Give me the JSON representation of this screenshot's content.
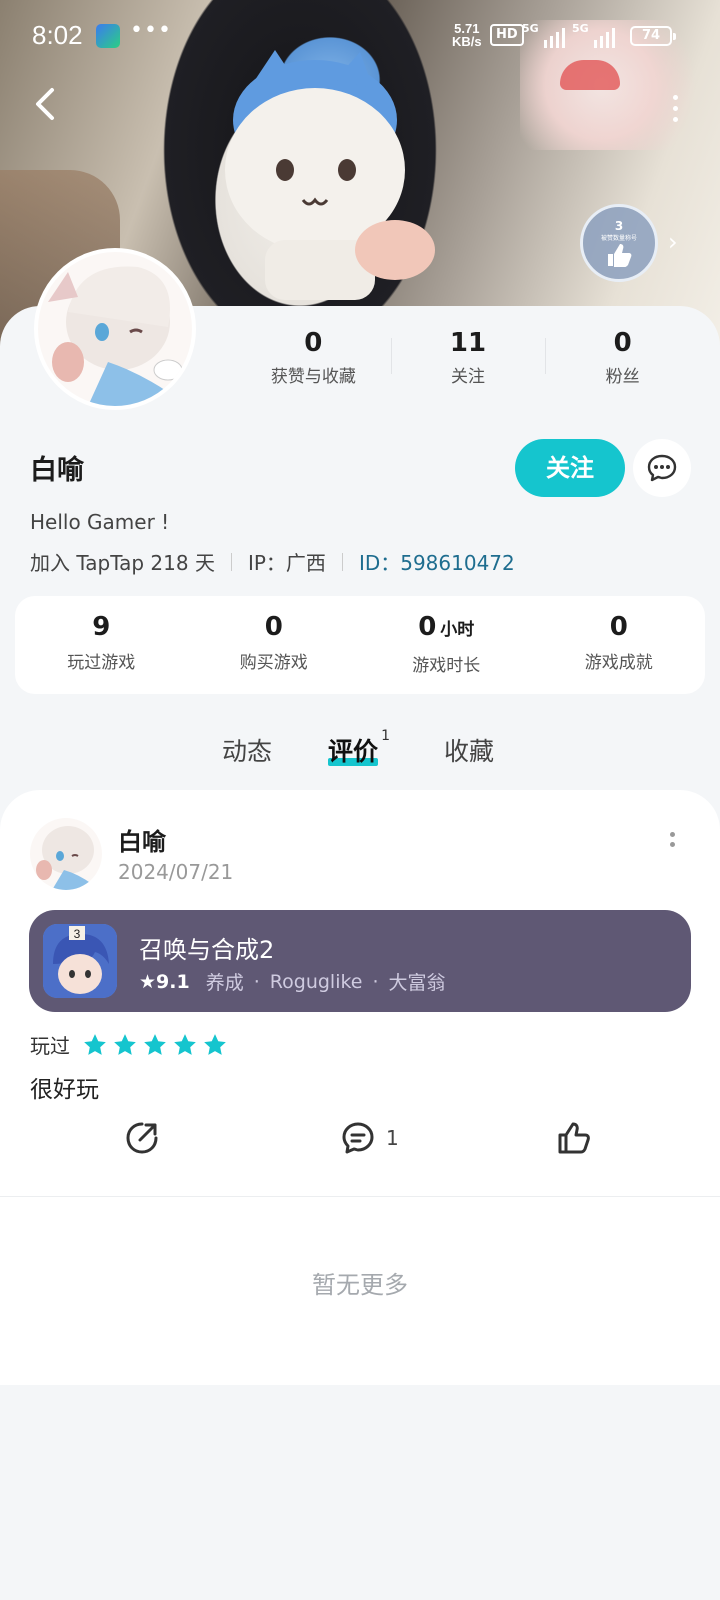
{
  "status_bar": {
    "time": "8:02",
    "dots": "•••",
    "net_speed_value": "5.71",
    "net_speed_unit": "KB/s",
    "hd_label": "HD",
    "sig1_label": "5G",
    "sig2_label": "5G",
    "battery": "74"
  },
  "cover": {
    "badge_number": "3",
    "badge_text": "被赞数量称号"
  },
  "profile": {
    "stats": [
      {
        "value": "0",
        "label": "获赞与收藏"
      },
      {
        "value": "11",
        "label": "关注"
      },
      {
        "value": "0",
        "label": "粉丝"
      }
    ],
    "username": "白喻",
    "follow_label": "关注",
    "bio": "Hello Gamer !",
    "joined": "加入 TapTap 218 天",
    "ip": "IP：广西",
    "id": "ID：598610472"
  },
  "game_stats": [
    {
      "value": "9",
      "unit": "",
      "label": "玩过游戏"
    },
    {
      "value": "0",
      "unit": "",
      "label": "购买游戏"
    },
    {
      "value": "0",
      "unit": "小时",
      "label": "游戏时长"
    },
    {
      "value": "0",
      "unit": "",
      "label": "游戏成就"
    }
  ],
  "tabs": [
    {
      "label": "动态"
    },
    {
      "label": "评价",
      "count": "1",
      "active": true
    },
    {
      "label": "收藏"
    }
  ],
  "review": {
    "author": "白喻",
    "date": "2024/07/21",
    "game": {
      "title": "召唤与合成2",
      "score": "9.1",
      "tags": [
        "养成",
        "Roguglike",
        "大富翁"
      ],
      "icon_badge": "3"
    },
    "played_label": "玩过",
    "rating": 5,
    "text": "很好玩",
    "comment_count": "1"
  },
  "footer": {
    "no_more": "暂无更多"
  },
  "colors": {
    "accent": "#15c5ce",
    "game_card": "#5f5874",
    "id_link": "#1e6d8f"
  }
}
